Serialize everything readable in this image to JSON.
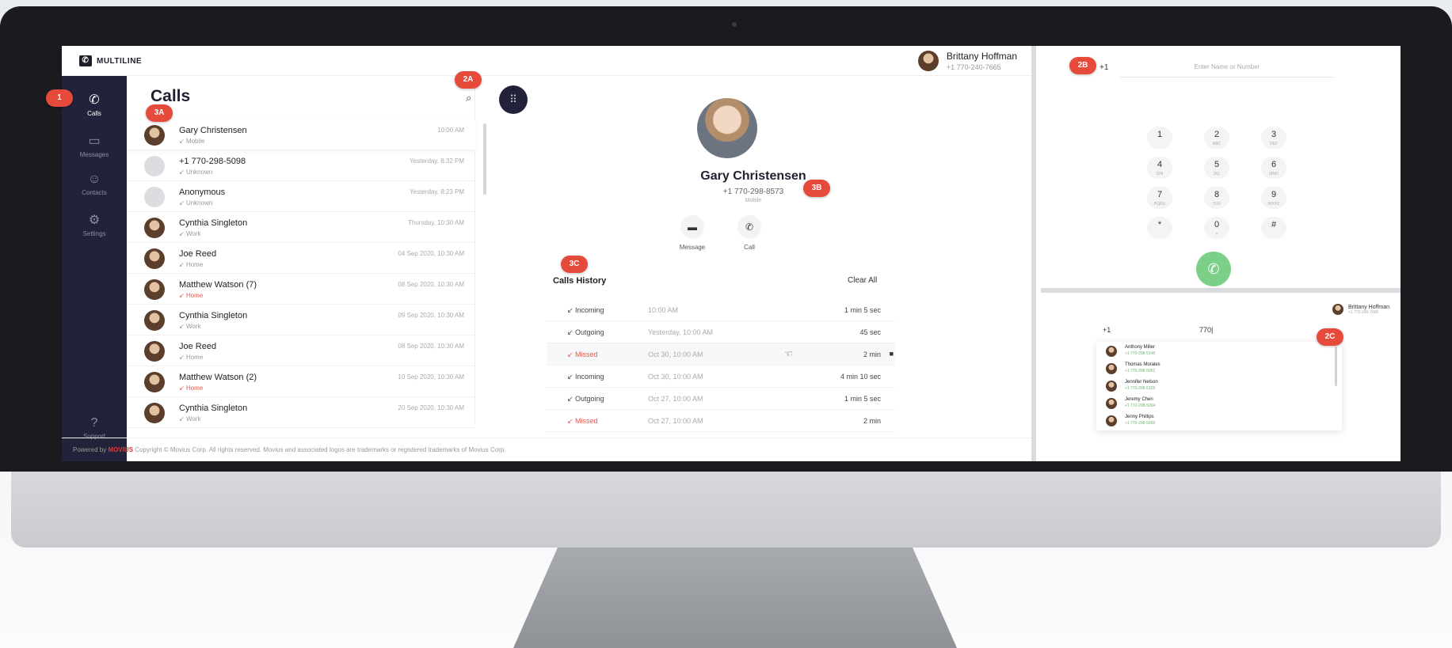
{
  "app": {
    "logo_text": "MULTILINE",
    "user": {
      "name": "Brittany Hoffman",
      "number": "+1 770-240-7665"
    }
  },
  "nav": {
    "items": [
      {
        "label": "Calls",
        "icon": "phone-icon"
      },
      {
        "label": "Messages",
        "icon": "message-icon"
      },
      {
        "label": "Contacts",
        "icon": "contacts-icon"
      },
      {
        "label": "Settings",
        "icon": "gear-icon"
      },
      {
        "label": "Support",
        "icon": "support-icon"
      }
    ]
  },
  "calls": {
    "title": "Calls",
    "list": [
      {
        "name": "Gary Christensen",
        "type": "Mobile",
        "time": "10:00 AM",
        "missed": false
      },
      {
        "name": "+1 770-298-5098",
        "type": "Unknown",
        "time": "Yesterday, 8:32 PM",
        "missed": false
      },
      {
        "name": "Anonymous",
        "type": "Unknown",
        "time": "Yesterday, 8:23 PM",
        "missed": false
      },
      {
        "name": "Cynthia Singleton",
        "type": "Work",
        "time": "Thursday, 10:30 AM",
        "missed": false
      },
      {
        "name": "Joe Reed",
        "type": "Home",
        "time": "04 Sep 2020, 10:30 AM",
        "missed": false
      },
      {
        "name": "Matthew Watson (7)",
        "type": "Home",
        "time": "08 Sep 2020, 10:30 AM",
        "missed": true
      },
      {
        "name": "Cynthia Singleton",
        "type": "Work",
        "time": "09 Sep 2020, 10:30 AM",
        "missed": false
      },
      {
        "name": "Joe Reed",
        "type": "Home",
        "time": "08 Sep 2020, 10:30 AM",
        "missed": false
      },
      {
        "name": "Matthew Watson (2)",
        "type": "Home",
        "time": "10 Sep 2020, 10:30 AM",
        "missed": true
      },
      {
        "name": "Cynthia Singleton",
        "type": "Work",
        "time": "20 Sep 2020, 10:30 AM",
        "missed": false
      }
    ]
  },
  "detail": {
    "name": "Gary Christensen",
    "number": "+1 770-298-8573",
    "type": "Mobile",
    "actions": {
      "message": "Message",
      "call": "Call"
    },
    "history_title": "Calls History",
    "clear_all": "Clear All",
    "history": [
      {
        "type": "Incoming",
        "date": "10:00 AM",
        "duration": "1 min 5 sec",
        "missed": false
      },
      {
        "type": "Outgoing",
        "date": "Yesterday, 10:00 AM",
        "duration": "45 sec",
        "missed": false
      },
      {
        "type": "Missed",
        "date": "Oct 30, 10:00 AM",
        "duration": "2 min",
        "missed": true
      },
      {
        "type": "Incoming",
        "date": "Oct 30, 10:00 AM",
        "duration": "4 min 10 sec",
        "missed": false
      },
      {
        "type": "Outgoing",
        "date": "Oct 27, 10:00 AM",
        "duration": "1 min 5 sec",
        "missed": false
      },
      {
        "type": "Missed",
        "date": "Oct 27, 10:00 AM",
        "duration": "2 min",
        "missed": true
      }
    ]
  },
  "footer": {
    "powered_by": "Powered by",
    "brand": "MOVIUS",
    "copyright": "Copyright © Movius Corp. All rights reserved. Movius and associated logos are trademarks or registered trademarks of Movius Corp."
  },
  "dialer": {
    "country_code": "+1",
    "placeholder": "Enter Name or Number",
    "keys": [
      {
        "d": "1",
        "s": ""
      },
      {
        "d": "2",
        "s": "ABC"
      },
      {
        "d": "3",
        "s": "DEF"
      },
      {
        "d": "4",
        "s": "GHI"
      },
      {
        "d": "5",
        "s": "JKL"
      },
      {
        "d": "6",
        "s": "MNO"
      },
      {
        "d": "7",
        "s": "PQRS"
      },
      {
        "d": "8",
        "s": "TUV"
      },
      {
        "d": "9",
        "s": "WXYZ"
      },
      {
        "d": "*",
        "s": ""
      },
      {
        "d": "0",
        "s": "+"
      },
      {
        "d": "#",
        "s": ""
      }
    ]
  },
  "mini": {
    "user_name": "Brittany Hoffman",
    "user_number": "+1 770-240-7665",
    "country_code": "+1",
    "query": "770|",
    "suggestions": [
      {
        "name": "Anthony Miller",
        "phone": "+1 770-298-5145"
      },
      {
        "name": "Thomas Morales",
        "phone": "+1 770-298-5051"
      },
      {
        "name": "Jennifer Nelson",
        "phone": "+1 770-298-5125"
      },
      {
        "name": "Jeremy Chen",
        "phone": "+1 770-298-5004"
      },
      {
        "name": "Jenny Phillips",
        "phone": "+1 770-298-5009"
      }
    ]
  },
  "badges": {
    "b1": "1",
    "b2a": "2A",
    "b2b": "2B",
    "b2c": "2C",
    "b3a": "3A",
    "b3b": "3B",
    "b3c": "3C"
  },
  "colors": {
    "accent": "#e64a3b",
    "nav_bg": "#22223a",
    "call_green": "#7ccf87",
    "missed": "#e55a4e"
  }
}
